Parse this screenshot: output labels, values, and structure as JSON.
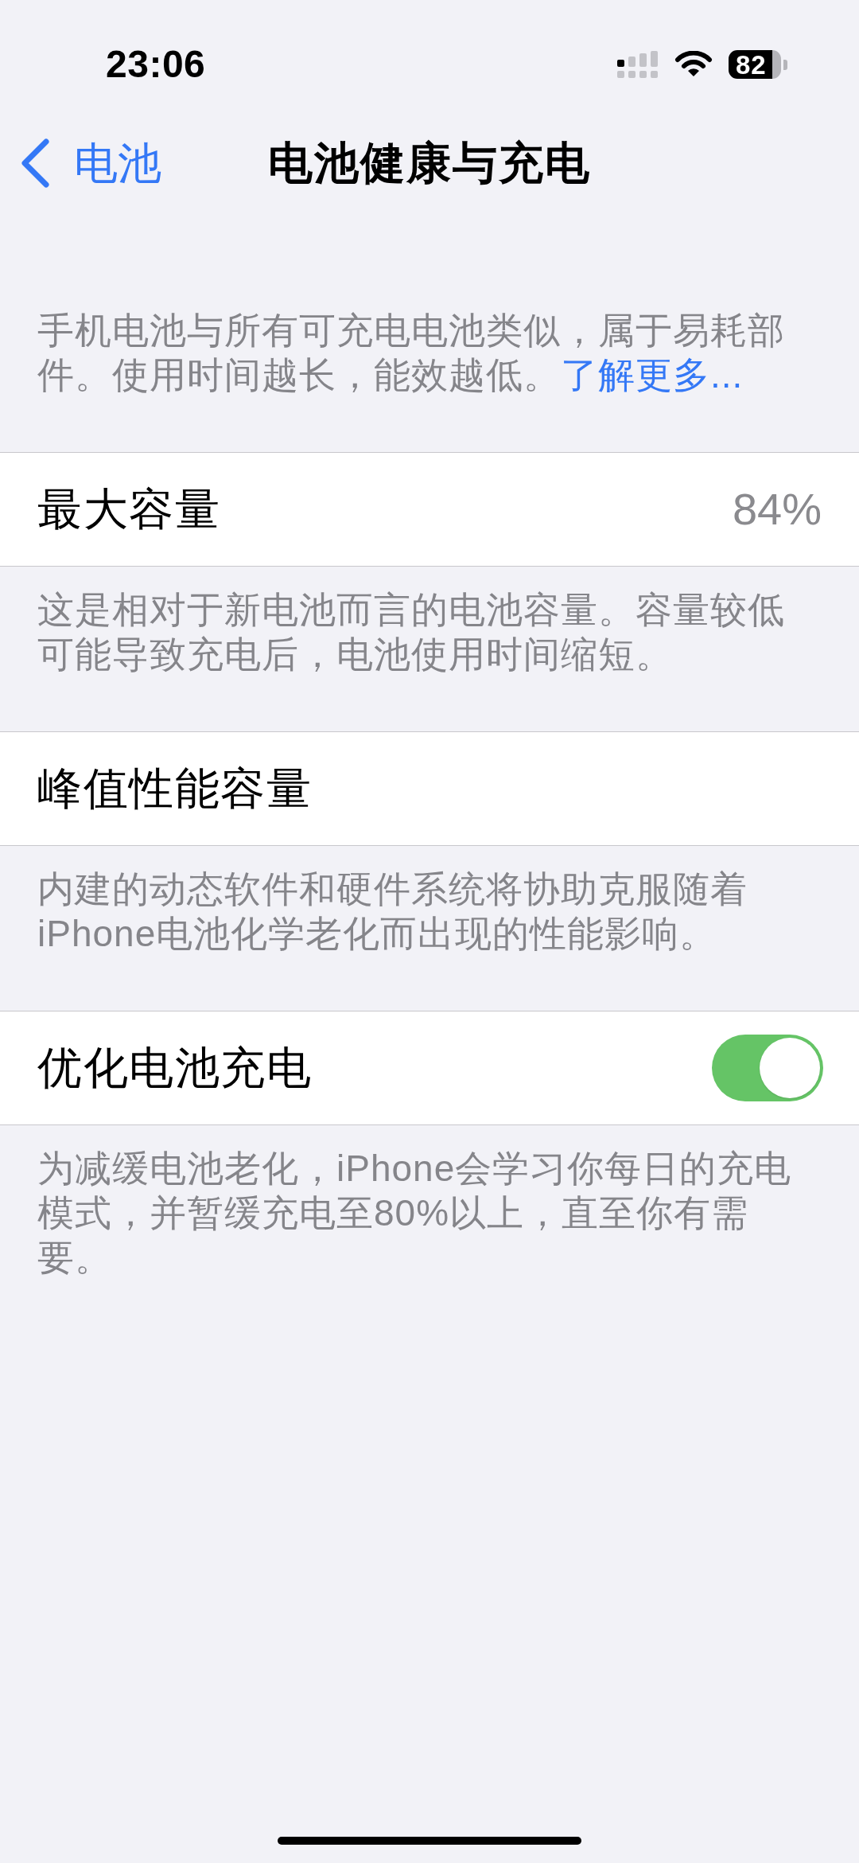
{
  "status_bar": {
    "time": "23:06",
    "battery": "82"
  },
  "nav_bar": {
    "back_label": "电池",
    "title": "电池健康与充电"
  },
  "intro": {
    "text": "手机电池与所有可充电电池类似，属于易耗部件。使用时间越长，能效越低。",
    "link": "了解更多..."
  },
  "sections": [
    {
      "kind": "value",
      "label": "最大容量",
      "value": "84%",
      "footer": "这是相对于新电池而言的电池容量。容量较低可能导致充电后，电池使用时间缩短。"
    },
    {
      "kind": "plain",
      "label": "峰值性能容量",
      "footer": "内建的动态软件和硬件系统将协助克服随着iPhone电池化学老化而出现的性能影响。"
    },
    {
      "kind": "toggle",
      "label": "优化电池充电",
      "on": true,
      "footer": "为减缓电池老化，iPhone会学习你每日的充电模式，并暂缓充电至80%以上，直至你有需要。"
    }
  ]
}
